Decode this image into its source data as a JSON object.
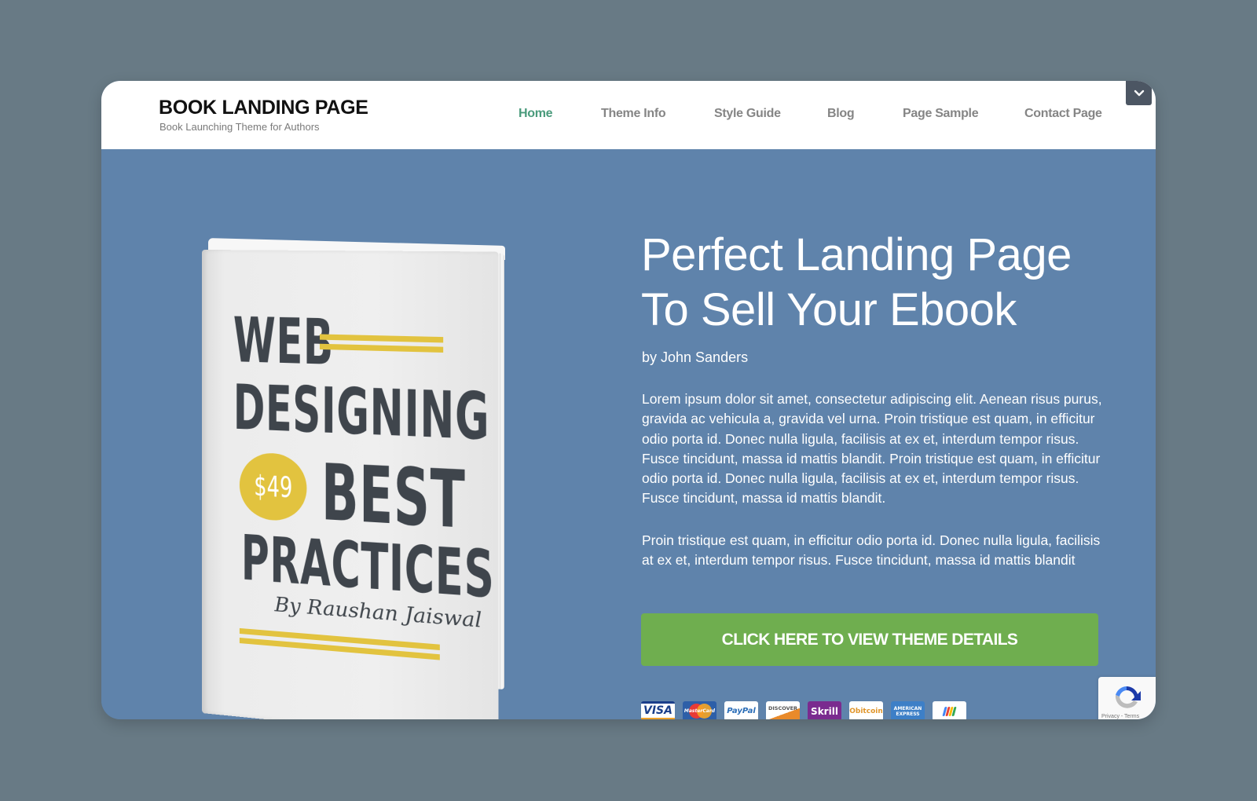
{
  "site": {
    "title": "BOOK LANDING PAGE",
    "tagline": "Book Launching Theme for Authors"
  },
  "nav": {
    "items": [
      {
        "label": "Home",
        "active": true
      },
      {
        "label": "Theme Info",
        "active": false
      },
      {
        "label": "Style Guide",
        "active": false
      },
      {
        "label": "Blog",
        "active": false
      },
      {
        "label": "Page Sample",
        "active": false
      },
      {
        "label": "Contact Page",
        "active": false
      }
    ],
    "toggle_icon": "chevron-down-icon"
  },
  "book": {
    "title_line1": "WEB",
    "title_line2": "DESIGNING",
    "title_line3": "BEST",
    "title_line4": "PRACTICES",
    "price": "$49",
    "author": "By Raushan Jaiswal"
  },
  "hero": {
    "title_line1": "Perfect Landing Page",
    "title_line2": "To Sell Your Ebook",
    "byline": "by John Sanders",
    "paragraph1": "Lorem ipsum dolor sit amet, consectetur adipiscing elit. Aenean risus purus, gravida ac vehicula a, gravida vel urna. Proin tristique est quam, in efficitur odio porta id. Donec nulla ligula, facilisis at ex et, interdum tempor risus. Fusce tincidunt, massa id mattis blandit. Proin tristique est quam, in efficitur odio porta id. Donec nulla ligula, facilisis at ex et, interdum tempor risus. Fusce tincidunt, massa id mattis blandit.",
    "paragraph2": "Proin tristique est quam, in efficitur odio porta id. Donec nulla ligula, facilisis at ex et, interdum tempor risus. Fusce tincidunt, massa id mattis blandit",
    "cta_label": "CLICK HERE TO VIEW THEME DETAILS"
  },
  "payments": [
    {
      "name": "visa",
      "label": "VISA"
    },
    {
      "name": "mastercard",
      "label": "MasterCard"
    },
    {
      "name": "paypal",
      "label": "PayPal"
    },
    {
      "name": "discover",
      "label": "DISCOVER"
    },
    {
      "name": "skrill",
      "label": "Skrill"
    },
    {
      "name": "bitcoin",
      "label": "Obitcoin"
    },
    {
      "name": "american-express",
      "label": "AMERICAN EXPRESS"
    },
    {
      "name": "google-wallet",
      "label": ""
    }
  ],
  "recaptcha": {
    "legal": "Privacy - Terms"
  },
  "colors": {
    "page_bg": "#687a85",
    "hero_bg": "#5f83ab",
    "nav_active": "#4a9b7c",
    "nav_inactive": "#858585",
    "cta_bg": "#6fae4f",
    "book_accent": "#e2c33f"
  }
}
